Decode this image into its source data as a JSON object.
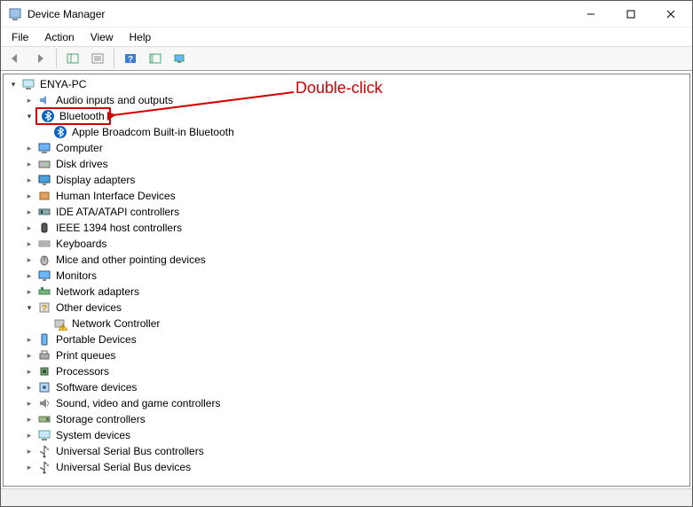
{
  "window": {
    "title": "Device Manager"
  },
  "menu": {
    "file": "File",
    "action": "Action",
    "view": "View",
    "help": "Help"
  },
  "annotation": {
    "text": "Double-click"
  },
  "tree": {
    "root": "ENYA-PC",
    "audio": "Audio inputs and outputs",
    "bluetooth": "Bluetooth",
    "bluetooth_child": "Apple Broadcom Built-in Bluetooth",
    "computer": "Computer",
    "disk": "Disk drives",
    "display": "Display adapters",
    "hid": "Human Interface Devices",
    "ide": "IDE ATA/ATAPI controllers",
    "ieee1394": "IEEE 1394 host controllers",
    "keyboards": "Keyboards",
    "mice": "Mice and other pointing devices",
    "monitors": "Monitors",
    "network": "Network adapters",
    "other": "Other devices",
    "other_child": "Network Controller",
    "portable": "Portable Devices",
    "printq": "Print queues",
    "processors": "Processors",
    "software": "Software devices",
    "sound": "Sound, video and game controllers",
    "storage": "Storage controllers",
    "system": "System devices",
    "usbctrl": "Universal Serial Bus controllers",
    "usbdev": "Universal Serial Bus devices"
  }
}
